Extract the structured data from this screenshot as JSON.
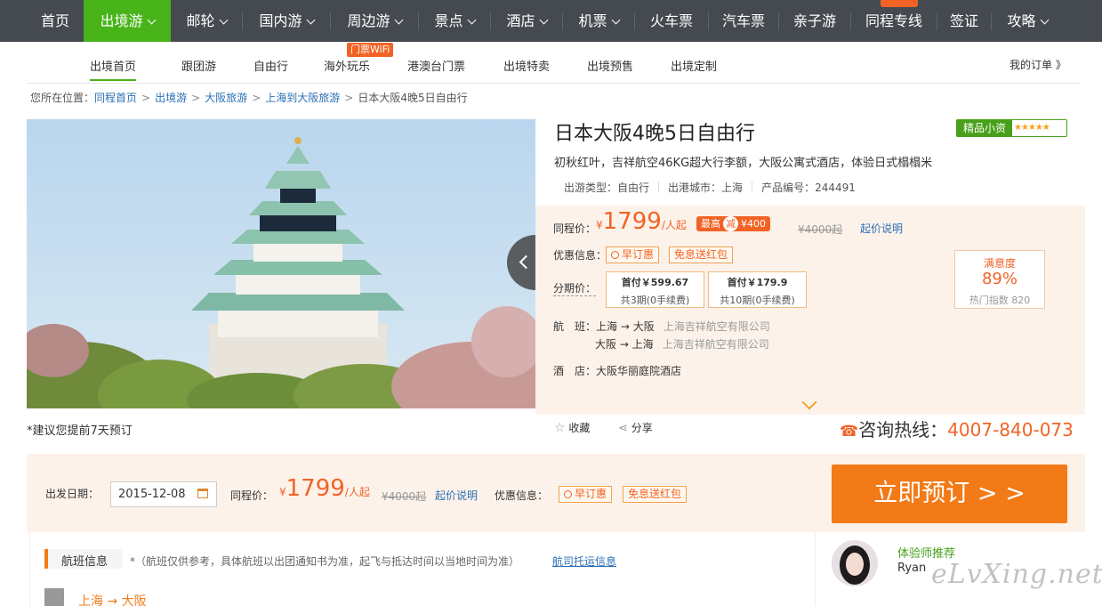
{
  "topnav": {
    "items": [
      {
        "label": "首页",
        "chevron": false
      },
      {
        "label": "出境游",
        "chevron": true,
        "active": true
      },
      {
        "label": "邮轮",
        "chevron": true
      },
      {
        "label": "国内游",
        "chevron": true
      },
      {
        "label": "周边游",
        "chevron": true
      },
      {
        "label": "景点",
        "chevron": true
      },
      {
        "label": "酒店",
        "chevron": true
      },
      {
        "label": "机票",
        "chevron": true
      },
      {
        "label": "火车票",
        "chevron": false
      },
      {
        "label": "汽车票",
        "chevron": false
      },
      {
        "label": "亲子游",
        "chevron": false
      },
      {
        "label": "同程专线",
        "chevron": false
      },
      {
        "label": "签证",
        "chevron": false
      },
      {
        "label": "攻略",
        "chevron": true
      }
    ]
  },
  "subnav": {
    "items": [
      "出境首页",
      "跟团游",
      "自由行",
      "海外玩乐",
      "港澳台门票",
      "出境特卖",
      "出境预售",
      "出境定制"
    ],
    "wifi_badge": "门票WiFi",
    "my_order": "我的订单 》"
  },
  "breadcrumb": {
    "prefix": "您所在位置：",
    "links": [
      "同程首页",
      "出境游",
      "大阪旅游",
      "上海到大阪旅游"
    ],
    "current": "日本大阪4晚5日自由行"
  },
  "product": {
    "title": "日本大阪4晚5日自由行",
    "badge": "精品小资",
    "stars": "★★★★★",
    "subtitle": "初秋红叶，吉祥航空46KG超大行李额，大阪公寓式酒店，体验日式榻榻米",
    "meta": {
      "type_label": "出游类型：",
      "type_value": "自由行",
      "city_label": "出港城市：",
      "city_value": "上海",
      "code_label": "产品编号：",
      "code_value": "244491"
    },
    "advice": "*建议您提前7天预订"
  },
  "price": {
    "label": "同程价：",
    "currency": "¥",
    "value": "1799",
    "unit": "/人起",
    "max_prefix": "最高",
    "max_jian": "减",
    "max_value": "¥400",
    "original": "¥4000起",
    "explain_link": "起价说明"
  },
  "promo": {
    "label": "优惠信息：",
    "tags": [
      "早订惠",
      "免息送红包"
    ]
  },
  "installment": {
    "label": "分期价：",
    "options": [
      {
        "first": "首付￥599.67",
        "detail": "共3期(0手续费)"
      },
      {
        "first": "首付￥179.9",
        "detail": "共10期(0手续费)"
      }
    ]
  },
  "flight": {
    "label": "航　班：",
    "routes": [
      {
        "route": "上海 → 大阪",
        "company": "上海吉祥航空有限公司"
      },
      {
        "route": "大阪 → 上海",
        "company": "上海吉祥航空有限公司"
      }
    ]
  },
  "hotel": {
    "label": "酒　店：",
    "name": "大阪华丽庭院酒店"
  },
  "satisfaction": {
    "title": "满意度",
    "value": "89%",
    "hot": "热门指数 820"
  },
  "actions": {
    "favorite": "收藏",
    "share": "分享"
  },
  "hotline": {
    "label": "咨询热线：",
    "number": "4007-840-073"
  },
  "booking": {
    "date_label": "出发日期：",
    "date_value": "2015-12-08",
    "price_label": "同程价：",
    "currency": "¥",
    "price": "1799",
    "unit": "/人起",
    "original": "¥4000起",
    "explain_link": "起价说明",
    "promo_label": "优惠信息：",
    "tags": [
      "早订惠",
      "免息送红包"
    ],
    "button": "立即预订 > >"
  },
  "flight_section": {
    "title": "航班信息",
    "note": "*（航班仅供参考，具体航班以出团通知书为准，起飞与抵达时间以当地时间为准）",
    "link": "航司托运信息",
    "route": "上海 → 大阪"
  },
  "recommend": {
    "title": "体验师推荐",
    "name": "Ryan"
  },
  "watermark": "eLvXing.net",
  "colors": {
    "nav_bg": "#444a4f",
    "active_green": "#48b41a",
    "accent_orange": "#f16325",
    "book_button": "#f27a17"
  }
}
